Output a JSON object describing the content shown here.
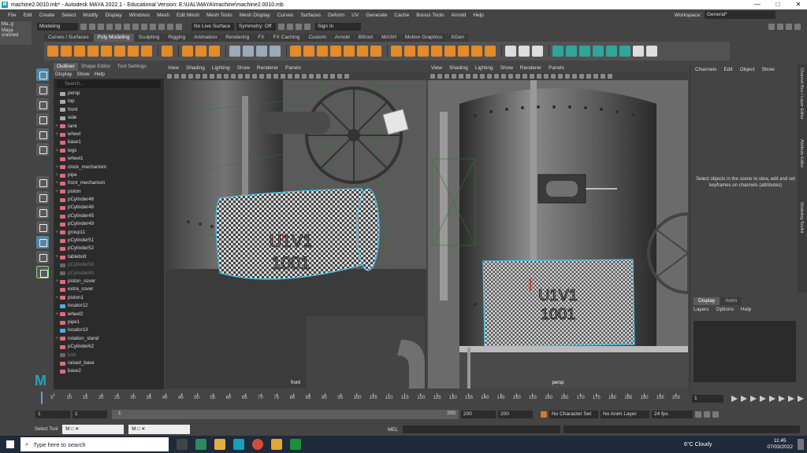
{
  "window": {
    "title": "machine2.0010.mb* - Autodesk MAYA 2022.1 - Educational Version: E:\\UAL\\MAYA\\machine\\machine2.0010.mb",
    "minimize": "—",
    "maximize": "□",
    "close": "✕"
  },
  "menubar": [
    "File",
    "Edit",
    "Create",
    "Select",
    "Modify",
    "Display",
    "Windows",
    "Mesh",
    "Edit Mesh",
    "Mesh Tools",
    "Mesh Display",
    "Curves",
    "Surfaces",
    "Deform",
    "UV",
    "Generate",
    "Cache",
    "Bonus Tools",
    "Arnold",
    "Help"
  ],
  "workspace": {
    "label": "Workspace:",
    "value": "General*"
  },
  "statusline": {
    "menuset": "Modeling",
    "live_surface": "No Live Surface",
    "symmetry": "Symmetry: Off",
    "sign_in": "Sign In"
  },
  "crash_label": "Maya crashed",
  "crash_tab": "Ma..g",
  "shelf_tabs": [
    "Curves / Surfaces",
    "Poly Modeling",
    "Sculpting",
    "Rigging",
    "Animation",
    "Rendering",
    "FX",
    "FX Caching",
    "Custom",
    "Arnold",
    "Bifrost",
    "MASH",
    "Motion Graphics",
    "XGen"
  ],
  "shelf_active": "Poly Modeling",
  "outliner": {
    "tabs": [
      "Outliner",
      "Shape Editor",
      "Tool Settings"
    ],
    "menu": [
      "Display",
      "Show",
      "Help"
    ],
    "search_placeholder": "Search...",
    "items": [
      {
        "label": "persp",
        "type": "camera",
        "exp": ""
      },
      {
        "label": "top",
        "type": "camera",
        "exp": ""
      },
      {
        "label": "front",
        "type": "camera",
        "exp": ""
      },
      {
        "label": "side",
        "type": "camera",
        "exp": ""
      },
      {
        "label": "tank",
        "type": "mesh",
        "exp": "+"
      },
      {
        "label": "wheel",
        "type": "mesh",
        "exp": "+"
      },
      {
        "label": "base1",
        "type": "mesh",
        "exp": ""
      },
      {
        "label": "legs",
        "type": "mesh",
        "exp": "+"
      },
      {
        "label": "wheel1",
        "type": "mesh",
        "exp": ""
      },
      {
        "label": "clock_mechanism",
        "type": "mesh",
        "exp": "+"
      },
      {
        "label": "pipe",
        "type": "mesh",
        "exp": "+"
      },
      {
        "label": "front_mechanism",
        "type": "mesh",
        "exp": "+"
      },
      {
        "label": "piston",
        "type": "mesh",
        "exp": "+"
      },
      {
        "label": "pCylinder46",
        "type": "mesh",
        "exp": ""
      },
      {
        "label": "pCylinder48",
        "type": "mesh",
        "exp": ""
      },
      {
        "label": "pCylinder45",
        "type": "mesh",
        "exp": ""
      },
      {
        "label": "pCylinder49",
        "type": "mesh",
        "exp": ""
      },
      {
        "label": "group11",
        "type": "mesh",
        "exp": "+"
      },
      {
        "label": "pCylinder51",
        "type": "mesh",
        "exp": ""
      },
      {
        "label": "pCylinder52",
        "type": "mesh",
        "exp": ""
      },
      {
        "label": "tablebolt",
        "type": "mesh",
        "exp": "+"
      },
      {
        "label": "pCylinder59",
        "type": "dim",
        "exp": ""
      },
      {
        "label": "pCylinder60",
        "type": "dim",
        "exp": ""
      },
      {
        "label": "piston_cover",
        "type": "mesh",
        "exp": "+"
      },
      {
        "label": "extra_cover",
        "type": "mesh",
        "exp": ""
      },
      {
        "label": "piston1",
        "type": "mesh",
        "exp": "+"
      },
      {
        "label": "locator12",
        "type": "locator",
        "exp": ""
      },
      {
        "label": "wheel2",
        "type": "mesh",
        "exp": "+"
      },
      {
        "label": "pipe1",
        "type": "mesh",
        "exp": ""
      },
      {
        "label": "locator13",
        "type": "locator",
        "exp": ""
      },
      {
        "label": "rotation_stand",
        "type": "mesh",
        "exp": "+"
      },
      {
        "label": "pCylinder62",
        "type": "mesh",
        "exp": ""
      },
      {
        "label": "bolt",
        "type": "dim",
        "exp": ""
      },
      {
        "label": "raised_base",
        "type": "mesh",
        "exp": ""
      },
      {
        "label": "base2",
        "type": "mesh",
        "exp": ""
      }
    ]
  },
  "viewport_menu": [
    "View",
    "Shading",
    "Lighting",
    "Show",
    "Renderer",
    "Panels"
  ],
  "viewport1": {
    "camera": "front"
  },
  "viewport2": {
    "camera": "persp"
  },
  "plate_text": {
    "line1": "U1V1",
    "line2": "1001"
  },
  "channel_box": {
    "menu": [
      "Channels",
      "Edit",
      "Object",
      "Show"
    ],
    "message": "Select objects in the scene to view, edit and set keyframes on channels (attributes)",
    "side_tabs": [
      "Channel Box / Layer Editor",
      "Attribute Editor",
      "Modeling Toolkit"
    ]
  },
  "layer_editor": {
    "tabs": [
      "Display",
      "Anim"
    ],
    "menu": [
      "Layers",
      "Options",
      "Help"
    ]
  },
  "timeline": {
    "ticks": [
      5,
      10,
      15,
      20,
      25,
      30,
      35,
      40,
      45,
      50,
      55,
      60,
      65,
      70,
      75,
      80,
      85,
      90,
      95,
      100,
      105,
      110,
      115,
      120,
      125,
      130,
      135,
      140,
      145,
      150,
      155,
      160,
      165,
      170,
      175,
      180,
      185,
      190,
      195,
      200
    ],
    "start": 1,
    "end": 200,
    "current_frame": "1"
  },
  "range": {
    "start": "1",
    "start_inner": "1",
    "slider_start": "1",
    "slider_end": "200",
    "end_inner": "200",
    "end": "200",
    "character_set": "No Character Set",
    "anim_layer": "No Anim Layer",
    "fps": "24 fps"
  },
  "cmd": {
    "label": "MEL"
  },
  "mini_windows": [
    "Select Tool"
  ],
  "taskbar": {
    "search_placeholder": "Type here to search",
    "weather": "6°C  Cloudy",
    "time": "11:45",
    "date": "07/03/2022"
  }
}
